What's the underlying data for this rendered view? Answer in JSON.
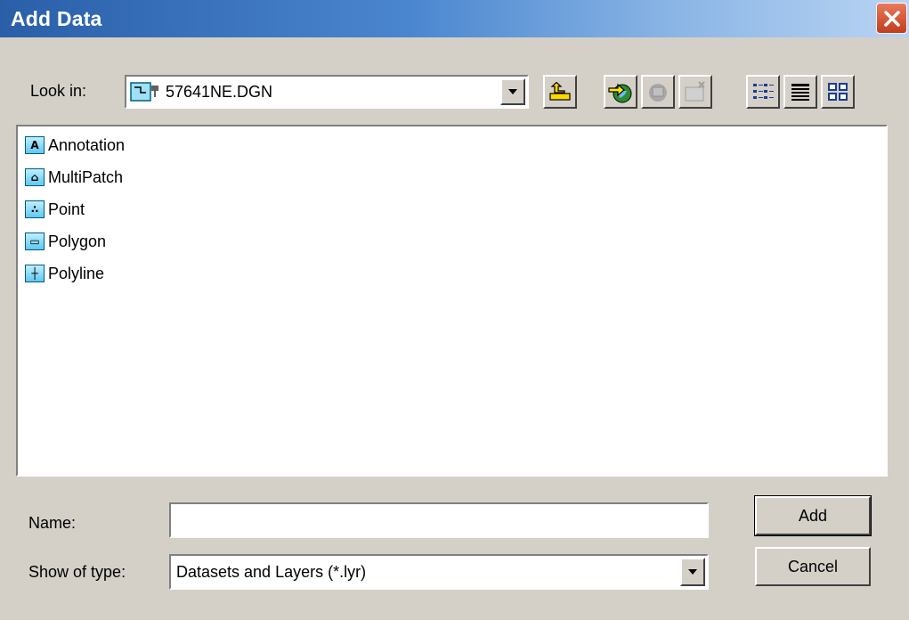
{
  "window": {
    "title": "Add Data"
  },
  "look_in": {
    "label": "Look in:",
    "value": "57641NE.DGN"
  },
  "toolbar": {
    "up_icon": "up-folder-icon",
    "connect_icon": "connect-folder-icon",
    "disconnect_icon": "disconnect-folder-icon",
    "new_folder_icon": "new-folder-icon",
    "list_view_icon": "list-view-icon",
    "details_view_icon": "details-view-icon",
    "thumbnails_icon": "thumbnails-icon"
  },
  "items": [
    {
      "label": "Annotation",
      "glyph": "A"
    },
    {
      "label": "MultiPatch",
      "glyph": "⌂"
    },
    {
      "label": "Point",
      "glyph": "∴"
    },
    {
      "label": "Polygon",
      "glyph": "▭"
    },
    {
      "label": "Polyline",
      "glyph": "┼"
    }
  ],
  "name_field": {
    "label": "Name:",
    "value": ""
  },
  "type_field": {
    "label": "Show of type:",
    "value": "Datasets and Layers (*.lyr)"
  },
  "buttons": {
    "add": "Add",
    "cancel": "Cancel"
  }
}
